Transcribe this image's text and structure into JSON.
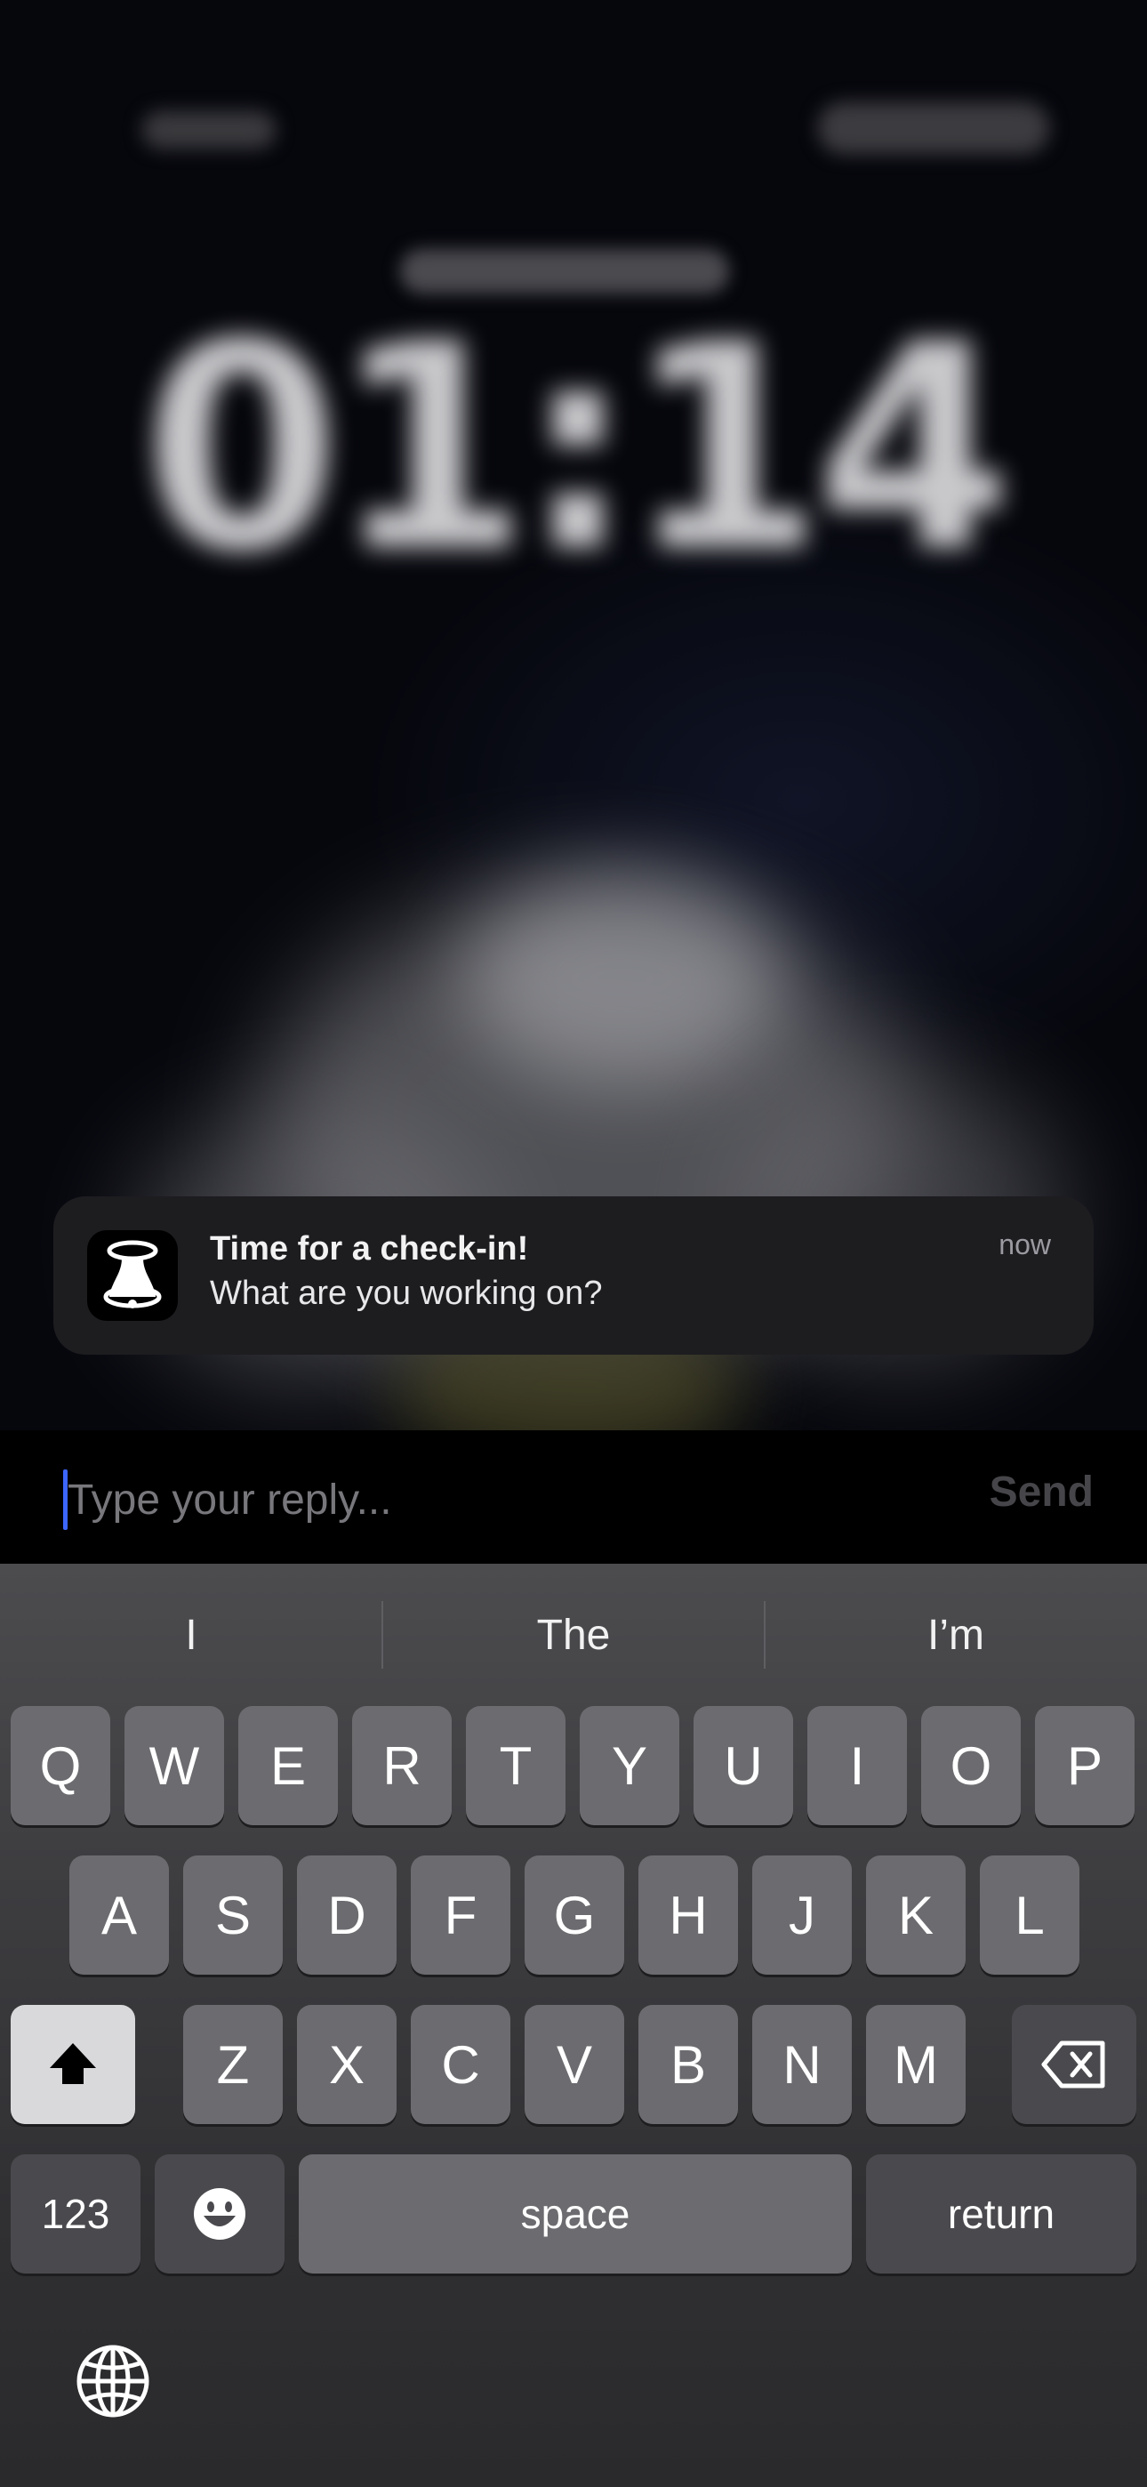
{
  "lock_screen": {
    "time": "01:14"
  },
  "notification": {
    "app_icon": "bell-icon",
    "title": "Time for a check-in!",
    "body": "What are you working on?",
    "timestamp": "now"
  },
  "reply": {
    "placeholder": "Type your reply...",
    "send_label": "Send"
  },
  "keyboard": {
    "suggestions": [
      "I",
      "The",
      "I’m"
    ],
    "row1": [
      "Q",
      "W",
      "E",
      "R",
      "T",
      "Y",
      "U",
      "I",
      "O",
      "P"
    ],
    "row2": [
      "A",
      "S",
      "D",
      "F",
      "G",
      "H",
      "J",
      "K",
      "L"
    ],
    "row3": [
      "Z",
      "X",
      "C",
      "V",
      "B",
      "N",
      "M"
    ],
    "shift_icon": "shift-arrow-icon",
    "delete_icon": "backspace-icon",
    "numbers_label": "123",
    "emoji_icon": "emoji-icon",
    "space_label": "space",
    "return_label": "return",
    "globe_icon": "globe-icon"
  }
}
